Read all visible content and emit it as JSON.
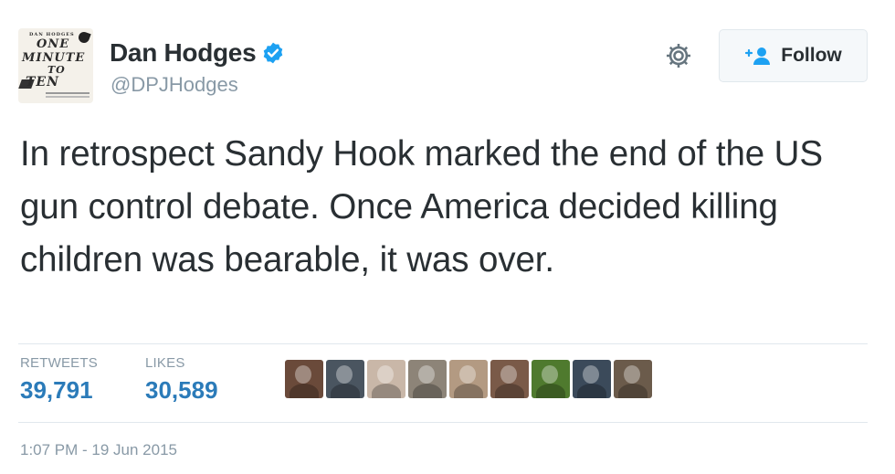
{
  "author": {
    "display_name": "Dan Hodges",
    "handle": "@DPJHodges",
    "avatar": {
      "top_text": "DAN HODGES",
      "title_lines": [
        "ONE",
        "MINUTE",
        "TO",
        "TEN"
      ]
    },
    "verified": true
  },
  "actions": {
    "follow_label": "Follow",
    "icons": [
      "gear-icon",
      "follow-user-icon",
      "verified-badge-icon"
    ]
  },
  "tweet": {
    "text": "In retrospect Sandy Hook marked the end of the US gun control debate. Once America decided killing children was bearable, it was over."
  },
  "stats": {
    "retweets_label": "RETWEETS",
    "retweets_value": "39,791",
    "likes_label": "LIKES",
    "likes_value": "30,589"
  },
  "likers": [
    {
      "color": "#6a4a3a"
    },
    {
      "color": "#4a5560"
    },
    {
      "color": "#c9b7a8"
    },
    {
      "color": "#8d8478"
    },
    {
      "color": "#b39a82"
    },
    {
      "color": "#7a5a48"
    },
    {
      "color": "#4f7a2e"
    },
    {
      "color": "#3b4a5a"
    },
    {
      "color": "#6b5b4b"
    }
  ],
  "timestamp": "1:07 PM - 19 Jun 2015",
  "colors": {
    "text": "#292f33",
    "muted": "#8899a6",
    "link": "#2b7bb9",
    "verified": "#1da1f2",
    "border": "#e1e8ed"
  }
}
